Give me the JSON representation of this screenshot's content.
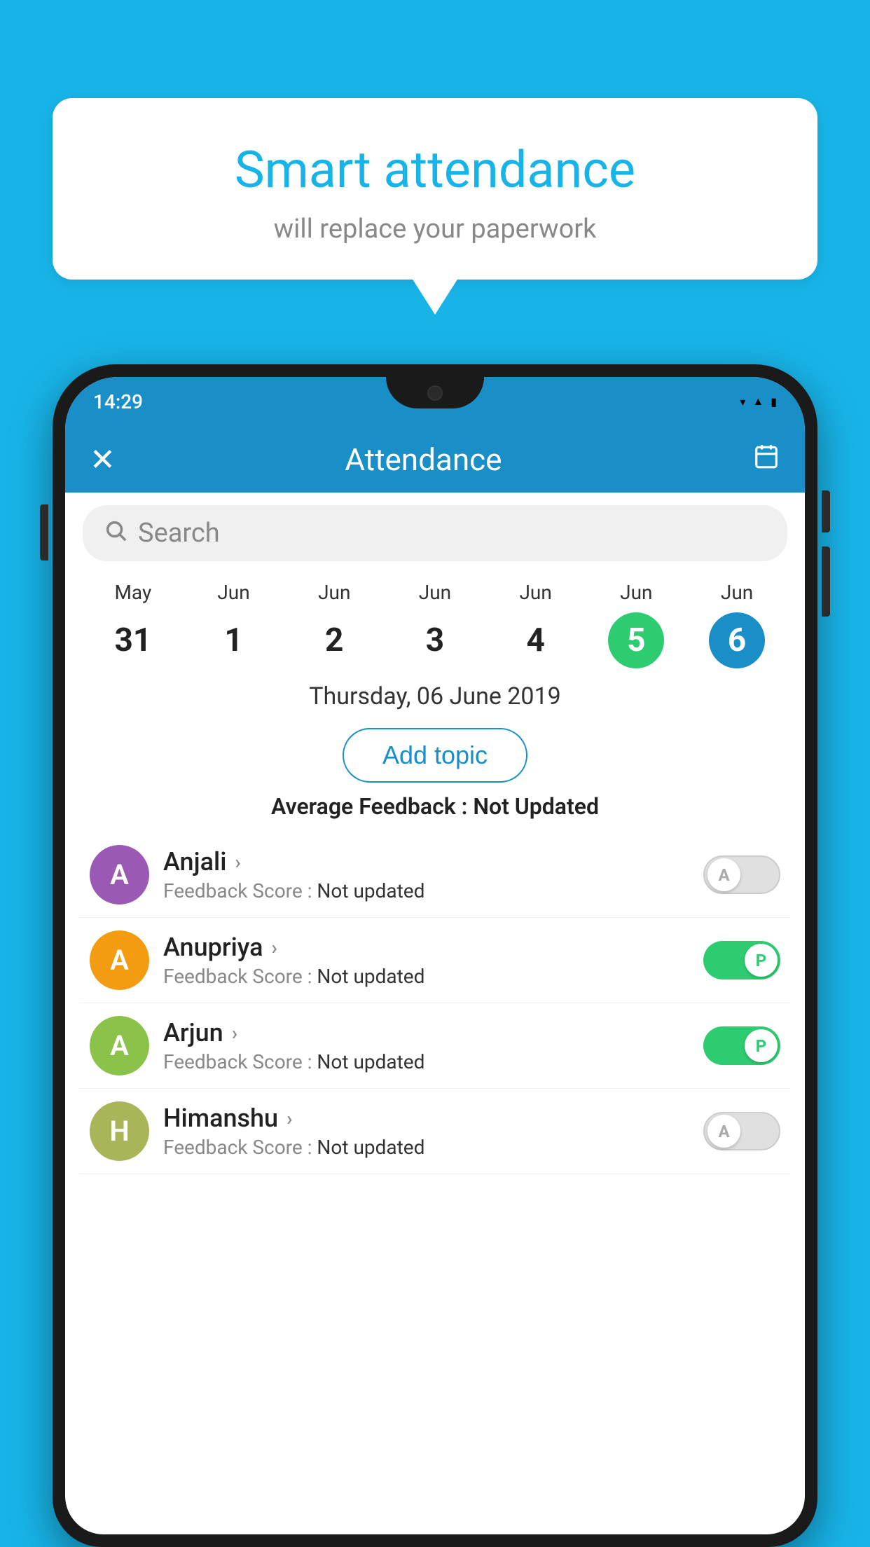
{
  "background_color": "#18b4e8",
  "bubble": {
    "title": "Smart attendance",
    "subtitle": "will replace your paperwork"
  },
  "status_bar": {
    "time": "14:29",
    "wifi_icon": "▾",
    "signal_icon": "▲",
    "battery_icon": "▮"
  },
  "header": {
    "title": "Attendance",
    "close_label": "✕",
    "calendar_icon": "📅"
  },
  "search": {
    "placeholder": "Search"
  },
  "calendar": {
    "days": [
      {
        "month": "May",
        "num": "31",
        "state": "normal"
      },
      {
        "month": "Jun",
        "num": "1",
        "state": "normal"
      },
      {
        "month": "Jun",
        "num": "2",
        "state": "normal"
      },
      {
        "month": "Jun",
        "num": "3",
        "state": "normal"
      },
      {
        "month": "Jun",
        "num": "4",
        "state": "normal"
      },
      {
        "month": "Jun",
        "num": "5",
        "state": "today"
      },
      {
        "month": "Jun",
        "num": "6",
        "state": "selected"
      }
    ]
  },
  "selected_date": "Thursday, 06 June 2019",
  "add_topic_label": "Add topic",
  "avg_feedback": {
    "label": "Average Feedback : ",
    "value": "Not Updated"
  },
  "students": [
    {
      "name": "Anjali",
      "avatar_letter": "A",
      "avatar_color": "#9b59b6",
      "feedback_label": "Feedback Score : ",
      "feedback_value": "Not updated",
      "toggle": "off",
      "toggle_letter": "A"
    },
    {
      "name": "Anupriya",
      "avatar_letter": "A",
      "avatar_color": "#f39c12",
      "feedback_label": "Feedback Score : ",
      "feedback_value": "Not updated",
      "toggle": "on",
      "toggle_letter": "P"
    },
    {
      "name": "Arjun",
      "avatar_letter": "A",
      "avatar_color": "#8bc34a",
      "feedback_label": "Feedback Score : ",
      "feedback_value": "Not updated",
      "toggle": "on",
      "toggle_letter": "P"
    },
    {
      "name": "Himanshu",
      "avatar_letter": "H",
      "avatar_color": "#aab55a",
      "feedback_label": "Feedback Score : ",
      "feedback_value": "Not updated",
      "toggle": "off",
      "toggle_letter": "A"
    }
  ]
}
